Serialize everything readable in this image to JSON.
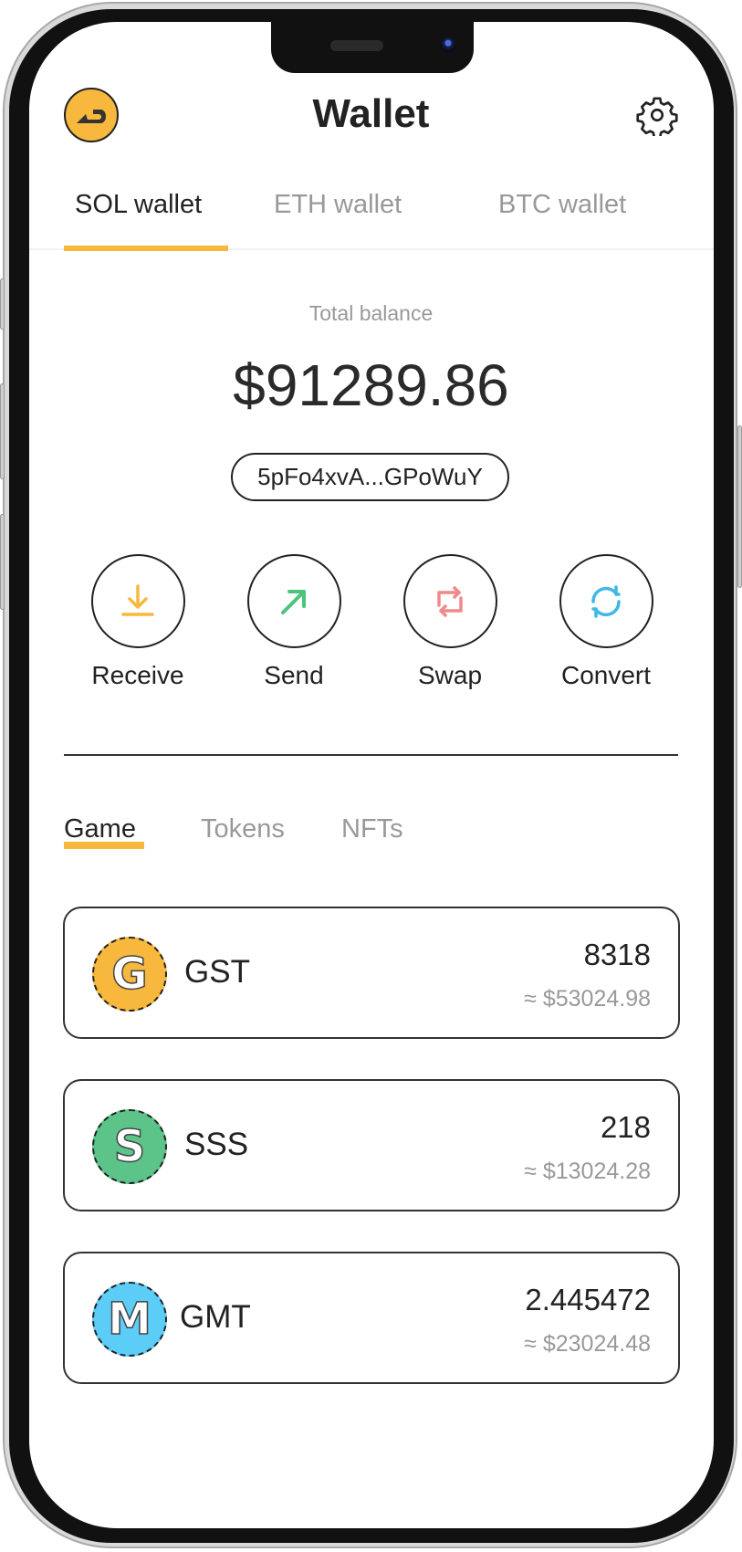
{
  "header": {
    "title": "Wallet",
    "logo_icon": "sneaker-logo-icon",
    "settings_icon": "gear-icon"
  },
  "wallet_tabs": [
    {
      "label": "SOL wallet",
      "active": true
    },
    {
      "label": "ETH wallet",
      "active": false
    },
    {
      "label": "BTC wallet",
      "active": false
    }
  ],
  "balance": {
    "label": "Total balance",
    "value": "$91289.86",
    "address": "5pFo4xvA...GPoWuY"
  },
  "actions": [
    {
      "label": "Receive",
      "icon": "download-icon",
      "color": "#f8b83e"
    },
    {
      "label": "Send",
      "icon": "arrow-up-right-icon",
      "color": "#4cc47a"
    },
    {
      "label": "Swap",
      "icon": "swap-icon",
      "color": "#f08a8a"
    },
    {
      "label": "Convert",
      "icon": "refresh-icon",
      "color": "#3fb8e8"
    }
  ],
  "asset_tabs": [
    {
      "label": "Game",
      "active": true
    },
    {
      "label": "Tokens",
      "active": false
    },
    {
      "label": "NFTs",
      "active": false
    }
  ],
  "tokens": [
    {
      "symbol": "GST",
      "letter": "G",
      "amount": "8318",
      "usd": "≈ $53024.98",
      "color": "#f8b83e"
    },
    {
      "symbol": "SSS",
      "letter": "S",
      "amount": "218",
      "usd": "≈ $13024.28",
      "color": "#5cc489"
    },
    {
      "symbol": "GMT",
      "letter": "M",
      "amount": "2.445472",
      "usd": "≈ $23024.48",
      "color": "#5ccdf7"
    }
  ],
  "colors": {
    "accent": "#f8b83e",
    "text_primary": "#222222",
    "text_secondary": "#999999"
  }
}
